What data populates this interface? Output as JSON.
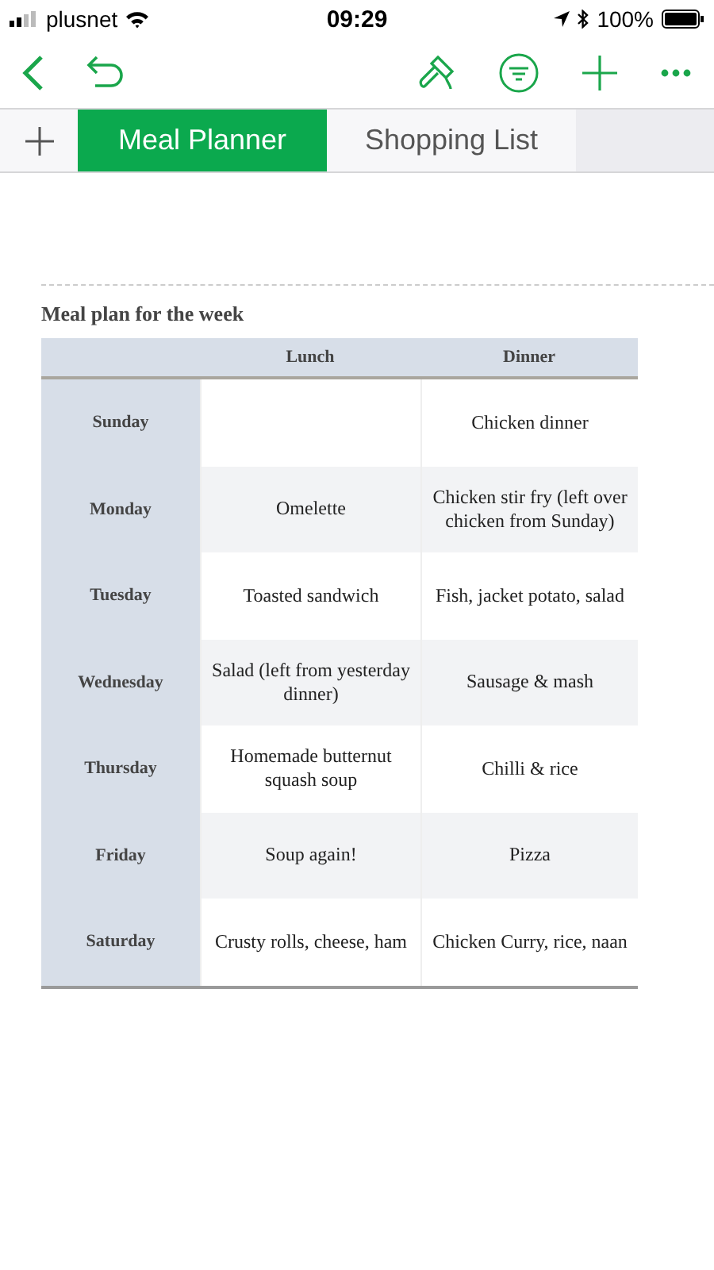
{
  "status_bar": {
    "carrier": "plusnet",
    "time": "09:29",
    "battery": "100%"
  },
  "tabs": [
    {
      "label": "Meal Planner",
      "selected": true
    },
    {
      "label": "Shopping List",
      "selected": false
    }
  ],
  "table": {
    "title": "Meal plan for the week",
    "columns": [
      "Lunch",
      "Dinner"
    ],
    "rows": [
      {
        "day": "Sunday",
        "cells": [
          "",
          "Chicken dinner"
        ]
      },
      {
        "day": "Monday",
        "cells": [
          "Omelette",
          "Chicken stir fry (left over chicken from Sunday)"
        ]
      },
      {
        "day": "Tuesday",
        "cells": [
          "Toasted sandwich",
          "Fish, jacket potato, salad"
        ]
      },
      {
        "day": "Wednesday",
        "cells": [
          "Salad (left from yesterday dinner)",
          "Sausage & mash"
        ]
      },
      {
        "day": "Thursday",
        "cells": [
          "Homemade butternut squash soup",
          "Chilli & rice"
        ]
      },
      {
        "day": "Friday",
        "cells": [
          "Soup again!",
          "Pizza"
        ]
      },
      {
        "day": "Saturday",
        "cells": [
          "Crusty rolls, cheese, ham",
          "Chicken Curry, rice, naan"
        ]
      }
    ]
  }
}
